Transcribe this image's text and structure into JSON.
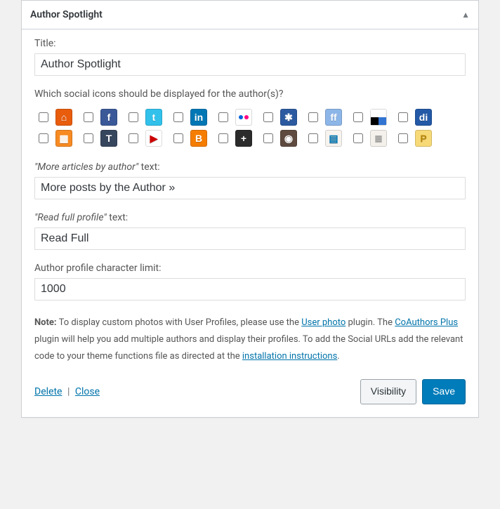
{
  "header": {
    "title": "Author Spotlight"
  },
  "fields": {
    "title_label": "Title:",
    "title_value": "Author Spotlight",
    "social_label": "Which social icons should be displayed for the author(s)?",
    "more_label_pre": "\"More articles by author\"",
    "more_label_post": " text:",
    "more_value": "More posts by the Author »",
    "readfull_label_pre": "\"Read full profile\"",
    "readfull_label_post": " text:",
    "readfull_value": "Read Full",
    "charlimit_label": "Author profile character limit:",
    "charlimit_value": "1000"
  },
  "social_icons": [
    {
      "name": "home",
      "glyph": "⌂",
      "checked": false
    },
    {
      "name": "facebook",
      "glyph": "f",
      "checked": false
    },
    {
      "name": "twitter",
      "glyph": "t",
      "checked": false
    },
    {
      "name": "linkedin",
      "glyph": "in",
      "checked": false
    },
    {
      "name": "flickr",
      "glyph": "",
      "checked": false
    },
    {
      "name": "diaspora",
      "glyph": "✱",
      "checked": false
    },
    {
      "name": "friendfeed",
      "glyph": "ff",
      "checked": false
    },
    {
      "name": "delicious",
      "glyph": "",
      "checked": false
    },
    {
      "name": "digg",
      "glyph": "di",
      "checked": false
    },
    {
      "name": "rss",
      "glyph": "▦",
      "checked": false
    },
    {
      "name": "tumblr",
      "glyph": "T",
      "checked": false
    },
    {
      "name": "youtube",
      "glyph": "▶",
      "checked": false
    },
    {
      "name": "blogger",
      "glyph": "B",
      "checked": false
    },
    {
      "name": "plus",
      "glyph": "+",
      "checked": false
    },
    {
      "name": "instagram",
      "glyph": "◉",
      "checked": false
    },
    {
      "name": "slideshare",
      "glyph": "▤",
      "checked": false
    },
    {
      "name": "stack",
      "glyph": "≣",
      "checked": false
    },
    {
      "name": "pocket",
      "glyph": "P",
      "checked": false
    }
  ],
  "note": {
    "prefix": "Note:",
    "t1": " To display custom photos with User Profiles, please use the ",
    "link1": "User photo",
    "t2": " plugin. The ",
    "link2": "CoAuthors Plus",
    "t3": " plugin will help you add multiple authors and display their profiles. To add the Social URLs add the relevant code to your theme functions file as directed at the ",
    "link3": "installation instructions",
    "t4": "."
  },
  "actions": {
    "delete": "Delete",
    "close": "Close",
    "visibility": "Visibility",
    "save": "Save"
  }
}
